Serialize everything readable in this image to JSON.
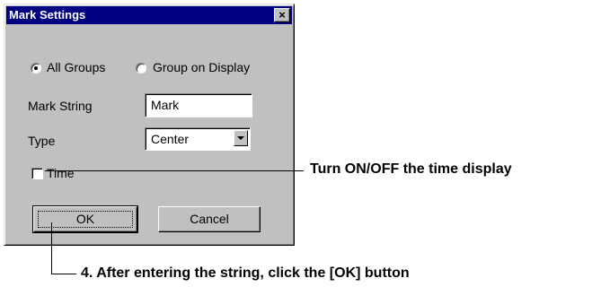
{
  "dialog": {
    "title": "Mark Settings",
    "close_symbol": "×",
    "radio_all_groups": "All Groups",
    "radio_group_on_display": "Group on Display",
    "selected_radio": "All Groups",
    "mark_string_label": "Mark String",
    "mark_string_value": "Mark",
    "type_label": "Type",
    "type_value": "Center",
    "time_label": "Time",
    "time_checked": false,
    "ok_label": "OK",
    "cancel_label": "Cancel"
  },
  "annotations": {
    "time": "Turn ON/OFF the time display",
    "ok": "4. After entering the string, click the [OK] button"
  },
  "colors": {
    "dialog_face": "#c0c0c0",
    "titlebar": "#000080"
  }
}
